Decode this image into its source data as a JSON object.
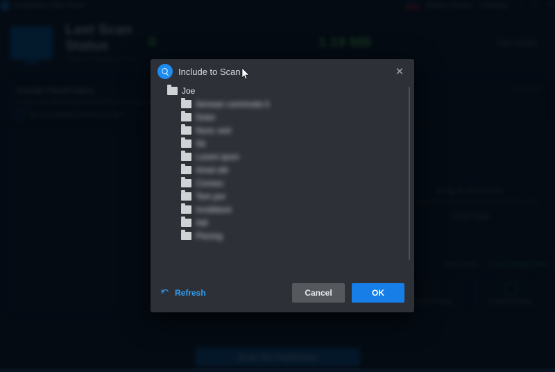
{
  "titlebar": {
    "app_name": "Duplicate Files Fixer",
    "action_center": "Action Center",
    "settings": "Settings"
  },
  "header": {
    "title1": "Last Scan",
    "title2": "Status",
    "timestamp": "03-08-21 06:30:19 PM",
    "count": "0",
    "size": "1.19 MB",
    "view_details": "View details"
  },
  "panel": {
    "title": "Include Files/Folders",
    "exclude": "Exclude",
    "subtitle": "Scans the following files/folders for duplicates",
    "path": "My Drive\\dharmshala pics fem"
  },
  "drop": {
    "title": "Drag & Drop here",
    "hint": "Drag folder from explorer to scan for duplicate files",
    "add": "+ Add Folder"
  },
  "modes": {
    "scan_mode": "Scan Mode",
    "gdrive": "Scan Google Drive"
  },
  "lowbtns": {
    "exclude": "Exclude Folder",
    "protect": "Protect Folder"
  },
  "scan_button": "Scan for Duplicates",
  "dialog": {
    "title": "Include to Scan",
    "root": "Joe",
    "children": [
      "Aenean commodo li",
      "Dolor",
      "Nunc sed",
      "Sit",
      "Lorem ipsm",
      "Amet elit",
      "Consec",
      "Tem por",
      "Incididunt",
      "Adi",
      "Piscing"
    ],
    "refresh": "Refresh",
    "cancel": "Cancel",
    "ok": "OK"
  }
}
